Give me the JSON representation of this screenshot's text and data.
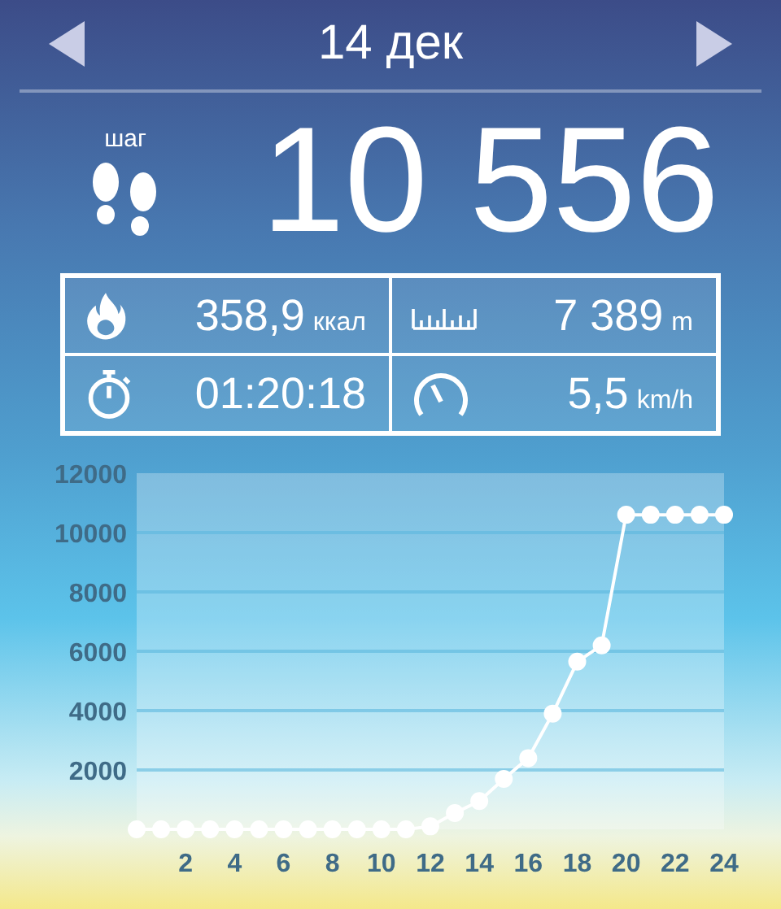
{
  "header": {
    "date": "14 дек"
  },
  "steps": {
    "unit": "шаг",
    "value": "10 556"
  },
  "stats": [
    {
      "kind": "calories",
      "value": "358,9",
      "unit": "ккал"
    },
    {
      "kind": "distance",
      "value": "7 389",
      "unit": "m"
    },
    {
      "kind": "duration",
      "value": "01:20:18"
    },
    {
      "kind": "speed",
      "value": "5,5",
      "unit": "km/h"
    }
  ],
  "chart_data": {
    "type": "line",
    "x": [
      0,
      1,
      2,
      3,
      4,
      5,
      6,
      7,
      8,
      9,
      10,
      11,
      12,
      13,
      14,
      15,
      16,
      17,
      18,
      19,
      20,
      21,
      22,
      23,
      24
    ],
    "series": [
      {
        "color": "#ffffff",
        "marker": "circle",
        "values": [
          0,
          0,
          0,
          0,
          0,
          0,
          0,
          0,
          0,
          0,
          0,
          0,
          100,
          550,
          950,
          1700,
          2400,
          3900,
          5650,
          6200,
          10600,
          10600,
          10600,
          10600,
          10600
        ]
      }
    ],
    "grid": true,
    "xlim": [
      0,
      24
    ],
    "ylim": [
      0,
      12000
    ],
    "xticks": [
      2,
      4,
      6,
      8,
      10,
      12,
      14,
      16,
      18,
      20,
      22,
      24
    ],
    "yticks": [
      2000,
      4000,
      6000,
      8000,
      10000,
      12000
    ]
  }
}
